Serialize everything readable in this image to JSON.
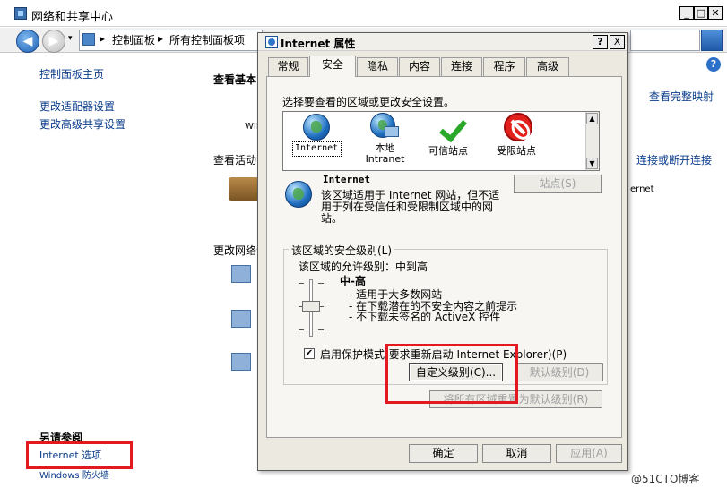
{
  "bg_window": {
    "title": "网络和共享中心",
    "breadcrumbs": [
      "控制面板",
      "所有控制面板项"
    ],
    "left_links": [
      "控制面板主页",
      "更改适配器设置",
      "更改高级共享设置"
    ],
    "see_also_heading": "另请参阅",
    "see_also_links": [
      "Internet 选项",
      "Windows 防火墙"
    ],
    "main_partial": {
      "view_basic": "查看基本",
      "view_full_map": "查看完整映射",
      "win_prefix": "WIN",
      "view_active": "查看活动",
      "connect_disconnect": "连接或断开连接",
      "internet_partial": "ernet",
      "change_network": "更改网络设"
    }
  },
  "dialog": {
    "title": "Internet 属性",
    "help_btn": "?",
    "close_btn": "X",
    "tabs": [
      {
        "label": "常规",
        "active": false
      },
      {
        "label": "安全",
        "active": true
      },
      {
        "label": "隐私",
        "active": false
      },
      {
        "label": "内容",
        "active": false
      },
      {
        "label": "连接",
        "active": false
      },
      {
        "label": "程序",
        "active": false
      },
      {
        "label": "高级",
        "active": false
      }
    ],
    "zone_prompt": "选择要查看的区域或更改安全设置。",
    "zones": [
      {
        "label": "Internet",
        "icon": "globe-icon",
        "selected": true
      },
      {
        "label": "本地\nIntranet",
        "icon": "local-intranet-icon",
        "selected": false
      },
      {
        "label": "可信站点",
        "icon": "checkmark-icon",
        "selected": false
      },
      {
        "label": "受限站点",
        "icon": "no-entry-icon",
        "selected": false
      }
    ],
    "zone_info": {
      "name": "Internet",
      "description": "该区域适用于 Internet 网站，但不适用于列在受信任和受限制区域中的网站。"
    },
    "sites_btn": "站点(S)",
    "security_level": {
      "group_title": "该区域的安全级别(L)",
      "allowed_levels": "该区域的允许级别：中到高",
      "level_name": "中-高",
      "descriptions": [
        "- 适用于大多数网站",
        "- 在下载潜在的不安全内容之前提示",
        "- 不下载未签名的 ActiveX 控件"
      ],
      "protected_mode_label": "启用保护模式(要求重新启动 Internet Explorer)(P)",
      "protected_mode_checked": true,
      "custom_level_btn": "自定义级别(C)...",
      "default_level_btn": "默认级别(D)",
      "reset_all_btn": "将所有区域重置为默认级别(R)"
    },
    "ok_btn": "确定",
    "cancel_btn": "取消",
    "apply_btn": "应用(A)"
  },
  "watermark": "@51CTO博客",
  "colors": {
    "highlight_red": "#e2191e",
    "dialog_bg": "#ece9e0",
    "link_blue": "#0b3d8c"
  }
}
